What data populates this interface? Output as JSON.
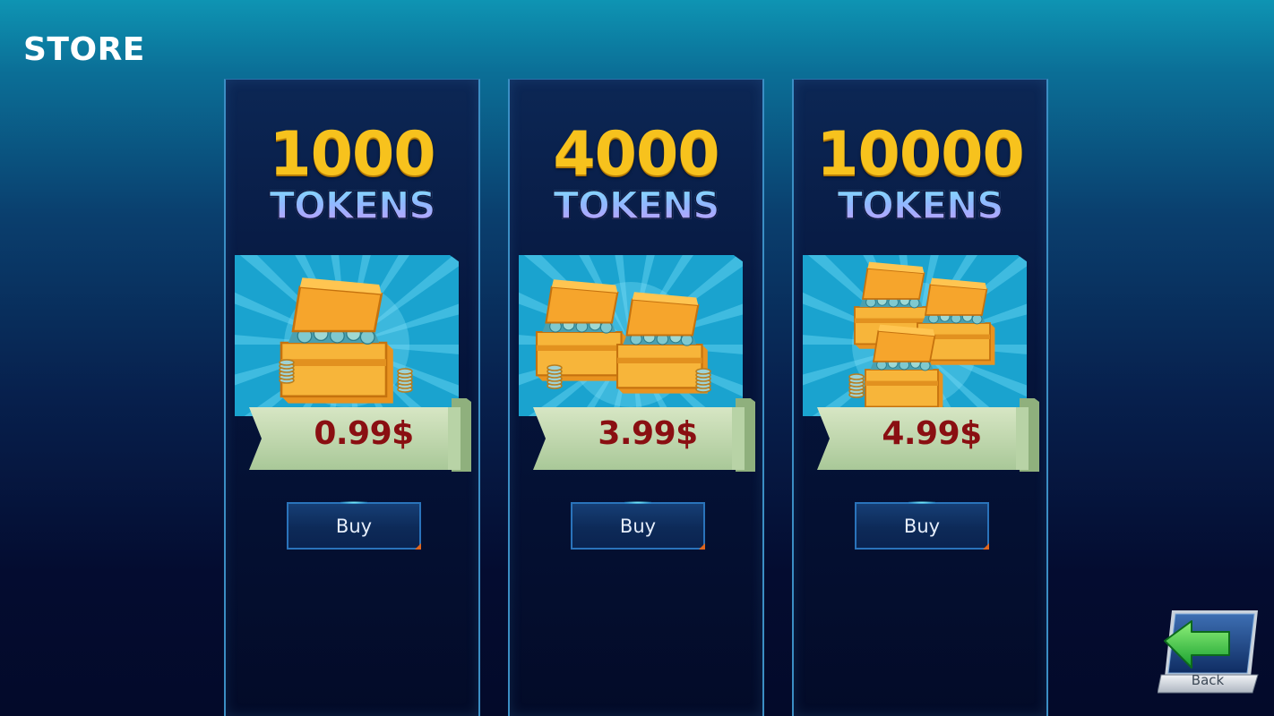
{
  "store": {
    "title": "STORE"
  },
  "offers": [
    {
      "amount": "1000",
      "unit": "TOKENS",
      "price": "0.99$",
      "buy_label": "Buy",
      "chest_count": 1
    },
    {
      "amount": "4000",
      "unit": "TOKENS",
      "price": "3.99$",
      "buy_label": "Buy",
      "chest_count": 2
    },
    {
      "amount": "10000",
      "unit": "TOKENS",
      "price": "4.99$",
      "buy_label": "Buy",
      "chest_count": 3
    }
  ],
  "back_button": {
    "label": "Back",
    "icon": "back-arrow-icon"
  },
  "colors": {
    "amount": "#f7c21d",
    "price": "#8a0f12",
    "ribbon": "#c8dfae",
    "chest": "#f3a42a",
    "buy_border": "#2a73bb",
    "back_arrow": "#27c83c"
  }
}
